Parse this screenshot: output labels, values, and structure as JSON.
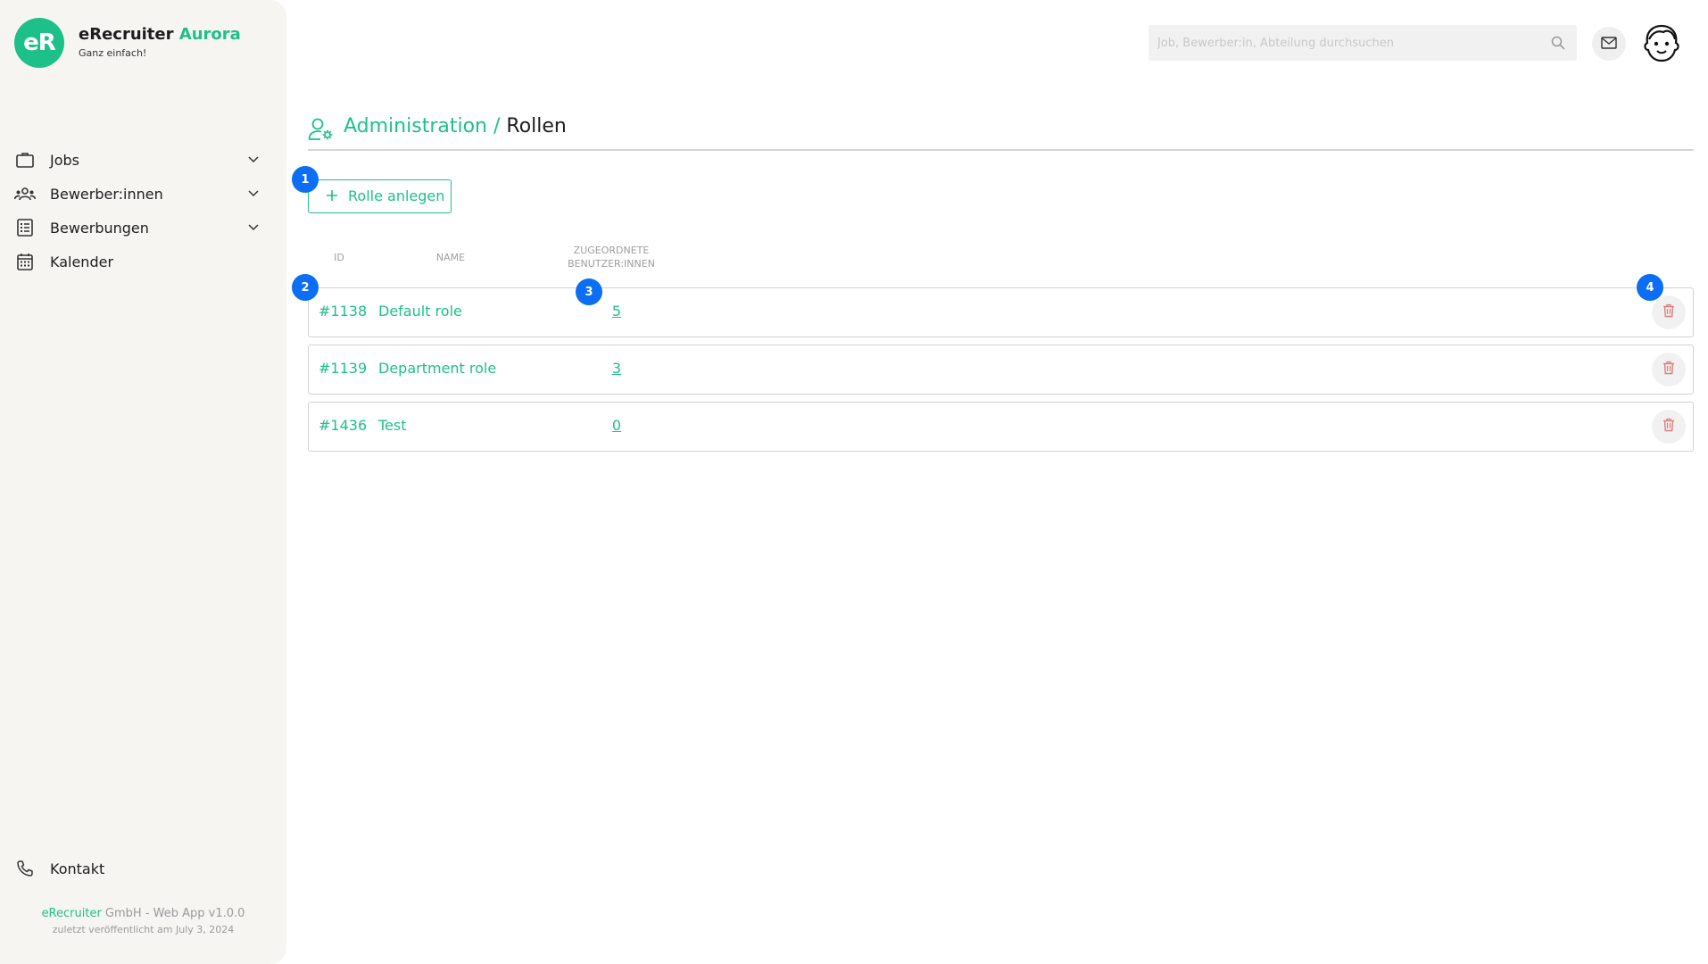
{
  "brand": {
    "logo_text": "eR",
    "name_part1": "eRecruiter",
    "name_part2": "Aurora",
    "tagline": "Ganz einfach!"
  },
  "sidebar": {
    "items": [
      {
        "label": "Jobs",
        "icon": "briefcase-icon",
        "expandable": true
      },
      {
        "label": "Bewerber:innen",
        "icon": "users-icon",
        "expandable": true
      },
      {
        "label": "Bewerbungen",
        "icon": "list-icon",
        "expandable": true
      },
      {
        "label": "Kalender",
        "icon": "calendar-icon",
        "expandable": false
      }
    ],
    "contact_label": "Kontakt",
    "footer_company_accent": "eRecruiter",
    "footer_company_rest": " GmbH - Web App v1.0.0",
    "footer_published": "zuletzt veröffentlicht am July 3, 2024"
  },
  "topbar": {
    "search_placeholder": "Job, Bewerber:in, Abteilung durchsuchen"
  },
  "page": {
    "breadcrumb_parent": "Administration /",
    "breadcrumb_current": "Rollen",
    "create_button_label": "Rolle anlegen"
  },
  "table": {
    "headers": {
      "id": "ID",
      "name": "NAME",
      "assigned_line1": "ZUGEORDNETE",
      "assigned_line2": "BENUTZER:INNEN"
    },
    "rows": [
      {
        "id": "#1138",
        "name": "Default role",
        "count": "5"
      },
      {
        "id": "#1139",
        "name": "Department role",
        "count": "3"
      },
      {
        "id": "#1436",
        "name": "Test",
        "count": "0"
      }
    ]
  },
  "annotations": [
    "1",
    "2",
    "3",
    "4"
  ],
  "colors": {
    "accent": "#1ec08a",
    "badge": "#0b6ef5",
    "delete": "#e07b7b",
    "sidebar_bg": "#f6f5f2"
  }
}
